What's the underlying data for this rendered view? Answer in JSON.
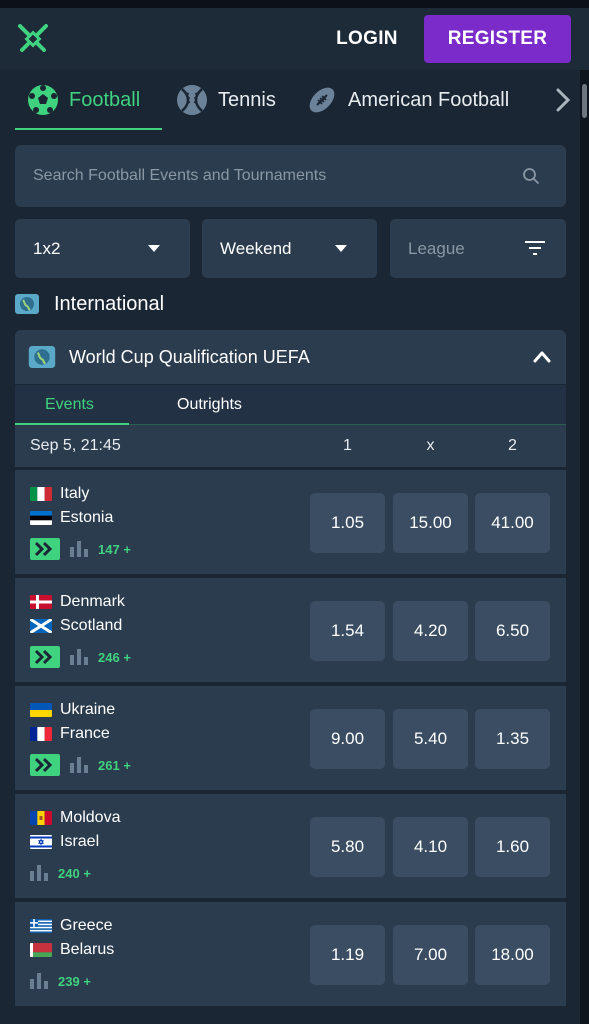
{
  "header": {
    "login_label": "LOGIN",
    "register_label": "REGISTER",
    "brand_accent": "#3fd27f",
    "register_color": "#7a2bc9"
  },
  "sport_tabs": [
    {
      "label": "Football",
      "icon": "soccer-ball-icon",
      "active": true
    },
    {
      "label": "Tennis",
      "icon": "tennis-ball-icon",
      "active": false
    },
    {
      "label": "American Football",
      "icon": "american-football-icon",
      "active": false
    }
  ],
  "search": {
    "placeholder": "Search Football Events and Tournaments",
    "value": ""
  },
  "filters": {
    "market": "1x2",
    "period": "Weekend",
    "league_placeholder": "League"
  },
  "region": {
    "name": "International"
  },
  "tournament": {
    "name": "World Cup Qualification UEFA",
    "subtabs": [
      "Events",
      "Outrights"
    ],
    "active_subtab": "Events"
  },
  "date_header": {
    "date": "Sep 5, 21:45",
    "col_1": "1",
    "col_x": "x",
    "col_2": "2"
  },
  "events": [
    {
      "home": "Italy",
      "away": "Estonia",
      "home_flag": "italy-flag",
      "away_flag": "estonia-flag",
      "live": true,
      "markets": "147",
      "odds": [
        "1.05",
        "15.00",
        "41.00"
      ]
    },
    {
      "home": "Denmark",
      "away": "Scotland",
      "home_flag": "denmark-flag",
      "away_flag": "scotland-flag",
      "live": true,
      "markets": "246",
      "odds": [
        "1.54",
        "4.20",
        "6.50"
      ]
    },
    {
      "home": "Ukraine",
      "away": "France",
      "home_flag": "ukraine-flag",
      "away_flag": "france-flag",
      "live": true,
      "markets": "261",
      "odds": [
        "9.00",
        "5.40",
        "1.35"
      ]
    },
    {
      "home": "Moldova",
      "away": "Israel",
      "home_flag": "moldova-flag",
      "away_flag": "israel-flag",
      "live": false,
      "markets": "240",
      "odds": [
        "5.80",
        "4.10",
        "1.60"
      ]
    },
    {
      "home": "Greece",
      "away": "Belarus",
      "home_flag": "greece-flag",
      "away_flag": "belarus-flag",
      "live": false,
      "markets": "239",
      "odds": [
        "1.19",
        "7.00",
        "18.00"
      ]
    }
  ],
  "more_suffix": "+"
}
